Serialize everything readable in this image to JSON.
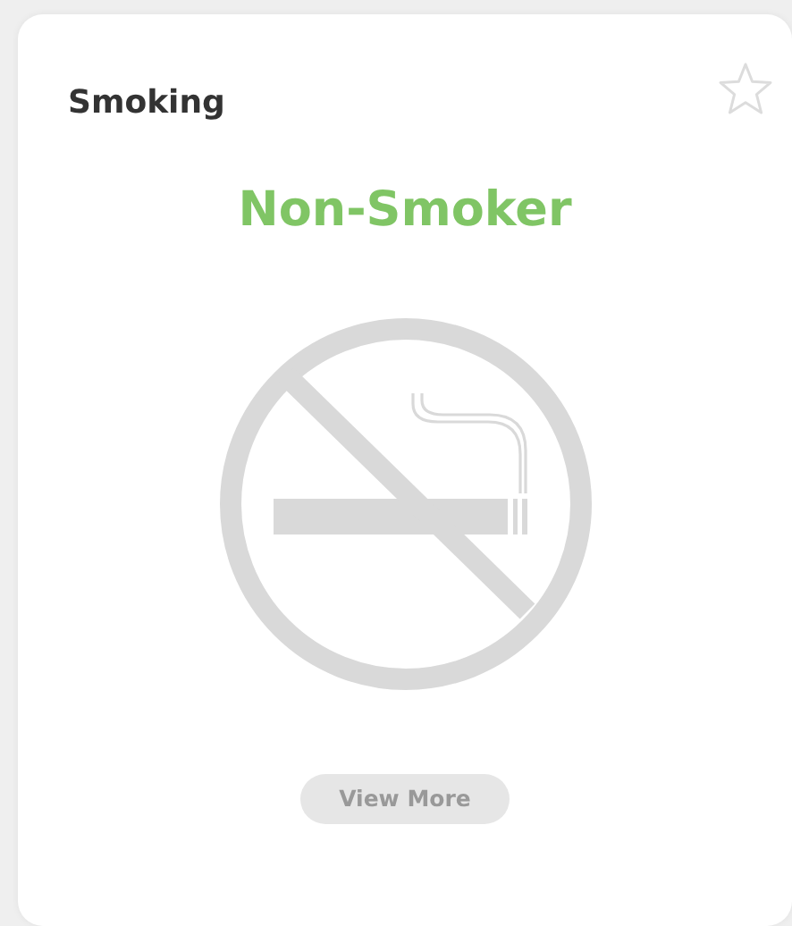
{
  "card": {
    "title": "Smoking",
    "favorite": false,
    "status": "Non-Smoker",
    "button": "View More"
  }
}
